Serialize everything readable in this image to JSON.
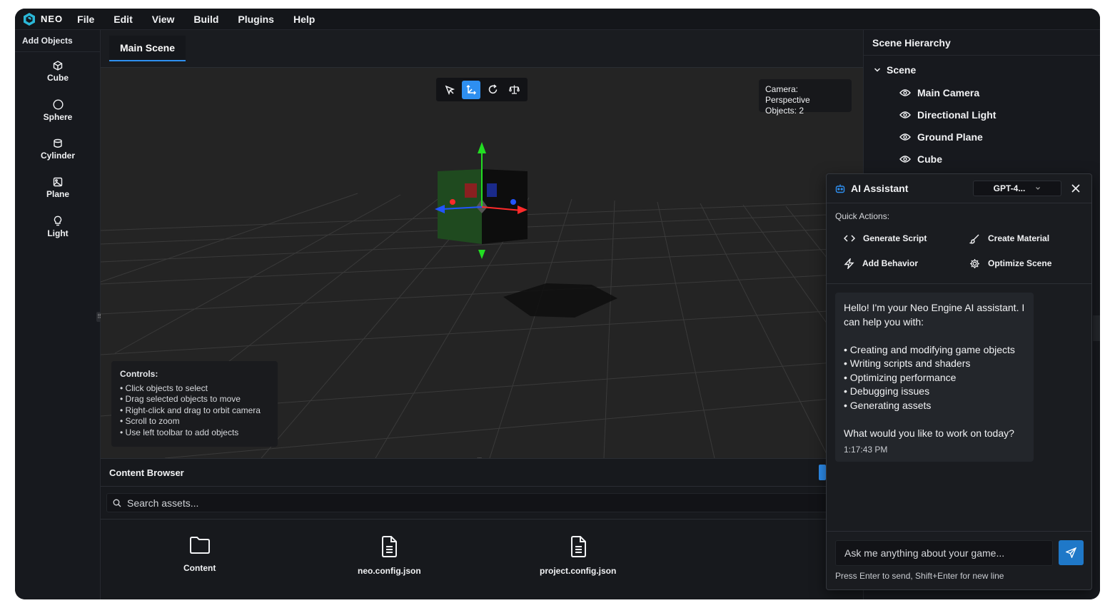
{
  "app": {
    "logo_text": "NEO"
  },
  "menu": [
    "File",
    "Edit",
    "View",
    "Build",
    "Plugins",
    "Help"
  ],
  "left_toolbar": {
    "title": "Add Objects",
    "tools": [
      {
        "label": "Cube",
        "icon": "cube-icon"
      },
      {
        "label": "Sphere",
        "icon": "sphere-icon"
      },
      {
        "label": "Cylinder",
        "icon": "cylinder-icon"
      },
      {
        "label": "Plane",
        "icon": "plane-icon"
      },
      {
        "label": "Light",
        "icon": "light-bulb-icon"
      }
    ]
  },
  "tabs": [
    {
      "label": "Main Scene",
      "active": true
    }
  ],
  "viewport": {
    "tools": [
      {
        "icon": "select-pointer-icon",
        "active": false
      },
      {
        "icon": "move-axes-icon",
        "active": true
      },
      {
        "icon": "rotate-icon",
        "active": false
      },
      {
        "icon": "scale-icon",
        "active": false
      }
    ],
    "camera_label": "Camera: Perspective",
    "objects_label": "Objects: 2",
    "controls": {
      "title": "Controls:",
      "items": [
        "• Click objects to select",
        "• Drag selected objects to move",
        "• Right-click and drag to orbit camera",
        "• Scroll to zoom",
        "• Use left toolbar to add objects"
      ]
    }
  },
  "content_browser": {
    "title": "Content Browser",
    "search_placeholder": "Search assets...",
    "assets": [
      {
        "name": "Content",
        "icon": "folder-icon"
      },
      {
        "name": "neo.config.json",
        "icon": "file-icon"
      },
      {
        "name": "project.config.json",
        "icon": "file-icon"
      }
    ]
  },
  "scene_hierarchy": {
    "title": "Scene Hierarchy",
    "root": "Scene",
    "items": [
      "Main Camera",
      "Directional Light",
      "Ground Plane",
      "Cube"
    ]
  },
  "ai_assistant": {
    "title": "AI Assistant",
    "model": "GPT-4...",
    "quick_actions_label": "Quick Actions:",
    "quick_actions": [
      {
        "label": "Generate Script",
        "icon": "code-icon"
      },
      {
        "label": "Create Material",
        "icon": "brush-icon"
      },
      {
        "label": "Add Behavior",
        "icon": "lightning-icon"
      },
      {
        "label": "Optimize Scene",
        "icon": "settings-icon"
      }
    ],
    "message": {
      "intro": "Hello! I'm your Neo Engine AI assistant. I can help you with:",
      "bullets": [
        "• Creating and modifying game objects",
        "• Writing scripts and shaders",
        "• Optimizing performance",
        "• Debugging issues",
        "• Generating assets"
      ],
      "question": "What would you like to work on today?",
      "timestamp": "1:17:43 PM"
    },
    "input_placeholder": "Ask me anything about your game...",
    "hint": "Press Enter to send, Shift+Enter for new line"
  },
  "colors": {
    "accent": "#2e8ff0",
    "background": "#16181d",
    "axis_x": "#ff2a2a",
    "axis_y": "#22dd22",
    "axis_z": "#2255ff"
  }
}
